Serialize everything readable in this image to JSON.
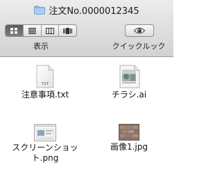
{
  "window": {
    "title": "注文No.0000012345"
  },
  "toolbar": {
    "view_label": "表示",
    "quicklook_label": "クイックルック",
    "view_modes": [
      "icon-view",
      "list-view",
      "column-view",
      "coverflow-view"
    ],
    "active_view": "icon-view"
  },
  "files": [
    {
      "name": "注意事項.txt",
      "icon": "text-file-icon",
      "badge": "TXT"
    },
    {
      "name": "チラシ.ai",
      "icon": "illustrator-file-icon"
    },
    {
      "name": "スクリーンショット.png",
      "icon": "screenshot-thumbnail-icon"
    },
    {
      "name": "画像1.jpg",
      "icon": "image-thumbnail-icon"
    }
  ]
}
